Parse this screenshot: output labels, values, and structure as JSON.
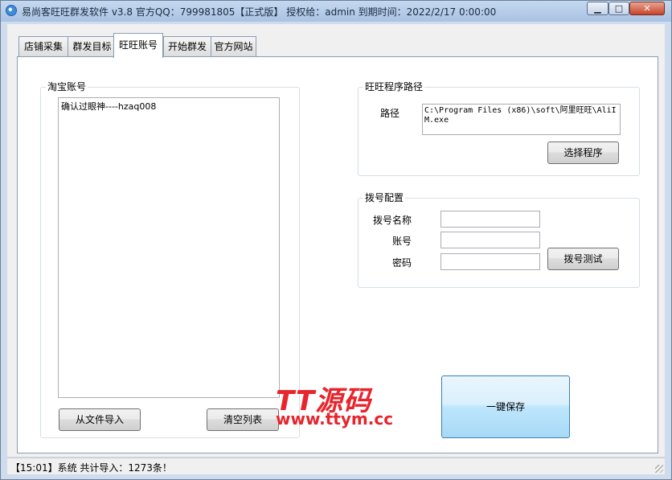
{
  "window": {
    "title": "易尚客旺旺群发软件 v3.8 官方QQ：799981805【正式版】 授权给：admin  到期时间：2022/2/17 0:00:00",
    "minimize_glyph": "▁",
    "maximize_glyph": "□",
    "close_glyph": "✕"
  },
  "tabs": [
    {
      "label": "店铺采集"
    },
    {
      "label": "群发目标"
    },
    {
      "label": "旺旺账号",
      "active": true
    },
    {
      "label": "开始群发"
    },
    {
      "label": "官方网站"
    }
  ],
  "taobao_accounts": {
    "group_title": "淘宝账号",
    "items": [
      "确认过眼神----hzaq008"
    ],
    "import_button": "从文件导入",
    "clear_button": "清空列表"
  },
  "wangwang_path": {
    "group_title": "旺旺程序路径",
    "path_label": "路径",
    "path_value": "C:\\Program Files (x86)\\soft\\阿里旺旺\\AliIM.exe",
    "choose_button": "选择程序"
  },
  "dial_config": {
    "group_title": "拨号配置",
    "name_label": "拨号名称",
    "account_label": "账号",
    "password_label": "密码",
    "name_value": "",
    "account_value": "",
    "password_value": "",
    "test_button": "拨号测试"
  },
  "save_button": "一键保存",
  "status": {
    "text": "【15:01】系统 共计导入：1273条！"
  },
  "watermark": {
    "logo": "TT源码",
    "url": "www.ttym.cc",
    "color": "#e8242c"
  }
}
